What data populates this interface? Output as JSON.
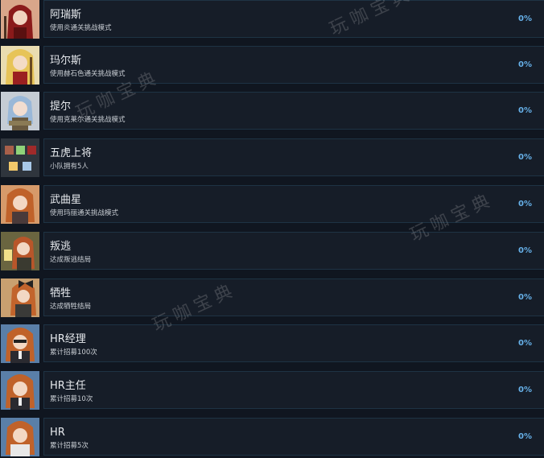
{
  "achievements": [
    {
      "title": "阿瑞斯",
      "desc": "使用炎通关挑战模式",
      "progress": "0%",
      "icon": "red-hood-character-icon",
      "accent": "#8a1a1a"
    },
    {
      "title": "玛尔斯",
      "desc": "使用赫石色通关挑战模式",
      "progress": "0%",
      "icon": "blonde-character-icon",
      "accent": "#d8b34a"
    },
    {
      "title": "提尔",
      "desc": "使用克莱尔通关挑战模式",
      "progress": "0%",
      "icon": "blue-hair-character-icon",
      "accent": "#6b8fb0"
    },
    {
      "title": "五虎上将",
      "desc": "小队拥有5人",
      "progress": "0%",
      "icon": "five-squares-icon",
      "accent": "#3a4048"
    },
    {
      "title": "武曲星",
      "desc": "使用玛丽通关挑战模式",
      "progress": "0%",
      "icon": "orange-hair-character-icon",
      "accent": "#c0622a"
    },
    {
      "title": "叛逃",
      "desc": "达成叛逃结局",
      "progress": "0%",
      "icon": "lantern-character-icon",
      "accent": "#b9b07a"
    },
    {
      "title": "牺牲",
      "desc": "达成牺牲结局",
      "progress": "0%",
      "icon": "bow-character-icon",
      "accent": "#c9a070"
    },
    {
      "title": "HR经理",
      "desc": "累计招募100次",
      "progress": "0%",
      "icon": "hr-manager-character-icon",
      "accent": "#5a7fa8"
    },
    {
      "title": "HR主任",
      "desc": "累计招募10次",
      "progress": "0%",
      "icon": "hr-director-character-icon",
      "accent": "#5a7fa8"
    },
    {
      "title": "HR",
      "desc": "累计招募5次",
      "progress": "0%",
      "icon": "hr-character-icon",
      "accent": "#5a7fa8"
    }
  ],
  "watermark": "玩咖宝典"
}
